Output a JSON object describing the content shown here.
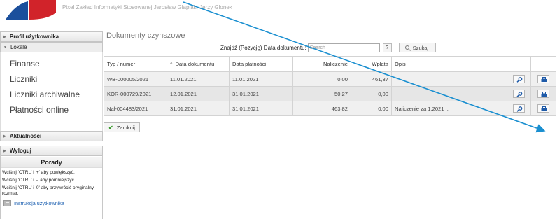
{
  "header": {
    "company": "Pixel Zakład Informatyki Stosowanej Jarosław Glapiak, Jerzy Glonek",
    "brand_color": "#d1232a"
  },
  "sidebar": {
    "sections": {
      "profile": "Profil użytkownika",
      "lokale": "Lokale",
      "news": "Aktualności",
      "logout": "Wyloguj"
    },
    "lokale_items": [
      "Finanse",
      "Liczniki",
      "Liczniki archiwalne",
      "Płatności online"
    ]
  },
  "tips": {
    "title": "Porady",
    "items": [
      "Wciśnij 'CTRL' i '+' aby powiększyć.",
      "Wciśnij 'CTRL' i '-' aby pomniejszyć.",
      "Wciśnij 'CTRL' i '0' aby przywrócić oryginalny rozmiar."
    ],
    "manual_link": "Instrukcja użytkownika"
  },
  "main": {
    "title": "Dokumenty czynszowe",
    "search_label": "Znajdź (Pozycję) Data dokumentu:",
    "search_placeholder": "Search",
    "help_label": "?",
    "find_label": "Szukaj",
    "close_label": "Zamknij"
  },
  "table": {
    "columns": {
      "type": "Typ / numer",
      "date": "Data dokumentu",
      "due": "Data płatności",
      "charge": "Naliczenie",
      "payment": "Wpłata",
      "desc": "Opis"
    },
    "sort_indicator": "^",
    "rows": [
      {
        "type": "WB-000005/2021",
        "date": "11.01.2021",
        "due": "11.01.2021",
        "charge": "0,00",
        "payment": "461,37",
        "desc": ""
      },
      {
        "type": "KOR-000729/2021",
        "date": "12.01.2021",
        "due": "31.01.2021",
        "charge": "50,27",
        "payment": "0,00",
        "desc": ""
      },
      {
        "type": "Nal-004483/2021",
        "date": "31.01.2021",
        "due": "31.01.2021",
        "charge": "463,82",
        "payment": "0,00",
        "desc": "Naliczenie za 1.2021 r."
      }
    ]
  },
  "colors": {
    "accent_link": "#1b5fb0",
    "annotation_line": "#1a8fd0",
    "row_alt": "#e6e6e6"
  }
}
